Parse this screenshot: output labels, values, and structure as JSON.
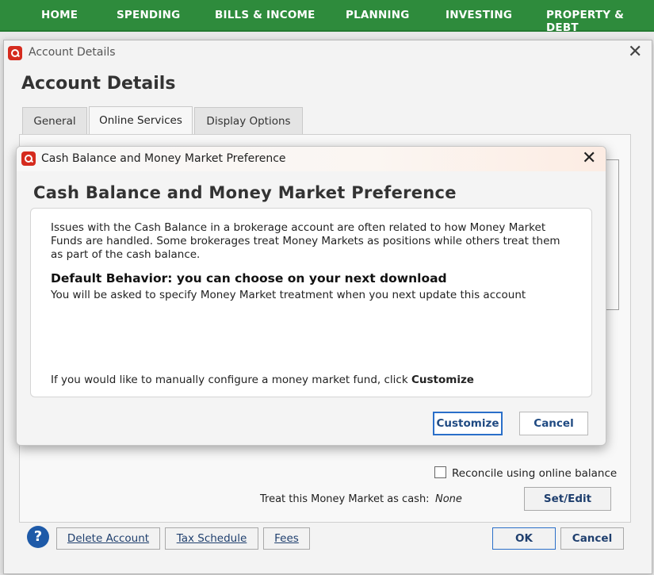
{
  "nav": {
    "items": [
      "HOME",
      "SPENDING",
      "BILLS & INCOME",
      "PLANNING",
      "INVESTING",
      "PROPERTY & DEBT"
    ]
  },
  "outer_window": {
    "title": "Account Details",
    "heading": "Account Details",
    "tabs": [
      "General",
      "Online Services",
      "Display Options"
    ],
    "active_tab": "Online Services",
    "reconcile_label": "Reconcile using online balance",
    "treat_label": "Treat this Money Market as cash:",
    "treat_value": "None",
    "set_edit_label": "Set/Edit",
    "delete_label": "Delete Account",
    "tax_label": "Tax Schedule",
    "fees_label": "Fees",
    "ok_label": "OK",
    "cancel_label": "Cancel",
    "help_glyph": "?"
  },
  "modal": {
    "title": "Cash Balance and Money Market Preference",
    "heading": "Cash Balance and Money Market Preference",
    "intro_lines": [
      "Issues with the Cash Balance in a brokerage account are often related to how Money Market",
      "Funds are handled. Some brokerages treat Money Markets as positions while others treat them",
      "as part of the cash balance."
    ],
    "default_heading": "Default Behavior: you can choose on your next download",
    "default_text": "You will be asked to specify Money Market treatment when you next update this account",
    "manual_text": "If you would like to manually configure a money market fund, click ",
    "manual_bold": "Customize",
    "customize_label": "Customize",
    "cancel_label": "Cancel"
  },
  "colors": {
    "nav_bg": "#2e8b3c",
    "brand_red": "#d52b1e",
    "link_blue": "#1f4a82",
    "help_blue": "#1e5aa8"
  }
}
